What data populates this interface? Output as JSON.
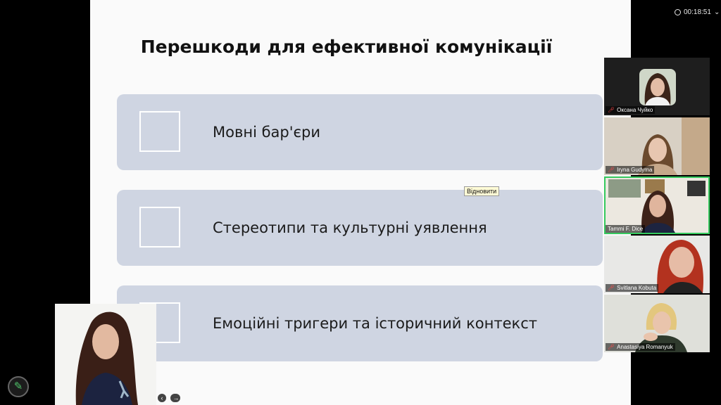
{
  "slide": {
    "title": "Перешкоди для ефективної комунікації",
    "items": [
      {
        "label": "Мовні бар'єри"
      },
      {
        "label": "Стереотипи та культурні уявлення"
      },
      {
        "label": "Емоційні тригери та історичний контекст"
      }
    ],
    "tooltip": "Відновити"
  },
  "meeting": {
    "elapsed": "00:18:51"
  },
  "participants": [
    {
      "name": "Оксана Чуйко",
      "muted": true
    },
    {
      "name": "Iryna Gudyma",
      "muted": true
    },
    {
      "name": "Tammi F. Dice",
      "muted": false,
      "active": true
    },
    {
      "name": "Svitlana Kobuta",
      "muted": true
    },
    {
      "name": "Anastasiya Romanyuk",
      "muted": true
    }
  ],
  "icons": {
    "clock": "clock-icon",
    "chevron": "chevron-down-icon",
    "pen": "pen-icon",
    "mic_off": "mic-off-icon"
  },
  "colors": {
    "box_fill": "#cfd5e2",
    "active_speaker": "#35c95e",
    "mic_off": "#ff4a4a"
  }
}
